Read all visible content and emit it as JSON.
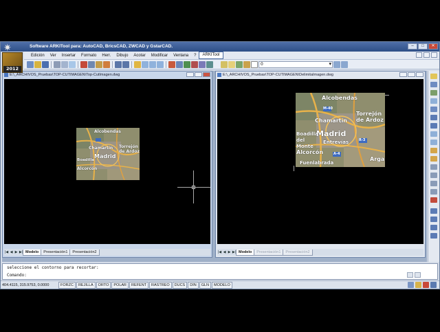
{
  "window": {
    "title": "Software ARKITool para: AutoCAD, BricsCAD, ZWCAD y GstarCAD.",
    "logo_year": "2012",
    "controls": [
      "–",
      "□",
      "✕"
    ]
  },
  "menu": {
    "items": [
      {
        "label": "Edición"
      },
      {
        "label": "Ver"
      },
      {
        "label": "Insertar"
      },
      {
        "label": "Formato"
      },
      {
        "label": "Herr."
      },
      {
        "label": "Dibujo"
      },
      {
        "label": "Acotar"
      },
      {
        "label": "Modificar"
      },
      {
        "label": "Ventana"
      },
      {
        "label": "?"
      },
      {
        "label": "ARKITool",
        "active": true
      }
    ]
  },
  "toolbar": {
    "layer_value": "0"
  },
  "documents": {
    "left": {
      "title": "E:\\_ARCHIVOS_Pruebas\\TOP-CUTIMAGEN\\Top-CutImagen.dwg",
      "tabs": [
        "Modelo",
        "Presentación1",
        "Presentación2"
      ],
      "active_tab": 0
    },
    "right": {
      "title": "E:\\_ARCHIVOS_Pruebas\\TOP-CUTIMAGEN\\DelimitaImagen.dwg",
      "tabs": [
        "Modelo",
        "Presentación1",
        "Presentación2"
      ],
      "active_tab": 0
    }
  },
  "map": {
    "labels": [
      "Alcobendas",
      "Torrejón de Ardoz",
      "Chamartín",
      "Madrid",
      "Entrevías",
      "Arganda",
      "Boadilla del Monte",
      "Alcorcón",
      "Fuenlabrada"
    ],
    "short_labels_left": [
      "Alcobendas",
      "Chamartín",
      "Madrid",
      "Torrejón de Ardoz",
      "Alcorcón",
      "Boadilla"
    ],
    "roads": [
      "M-40",
      "M-30",
      "A-4",
      "R-3"
    ]
  },
  "command": {
    "line1": "seleccione el contorno para recortar:",
    "prompt": "Comando:"
  },
  "status": {
    "coords": "404.4115, 315.9753, 0.0000",
    "buttons": [
      "FORZC",
      "REJILLA",
      "ORTO",
      "POLAR",
      "REFENT",
      "RASTREO",
      "DUCS",
      "DIN",
      "GLN",
      "MODELO"
    ]
  },
  "colors": {
    "titlebar": "#2e4f87",
    "canvas": "#000000",
    "window_bg": "#d6dde9"
  }
}
